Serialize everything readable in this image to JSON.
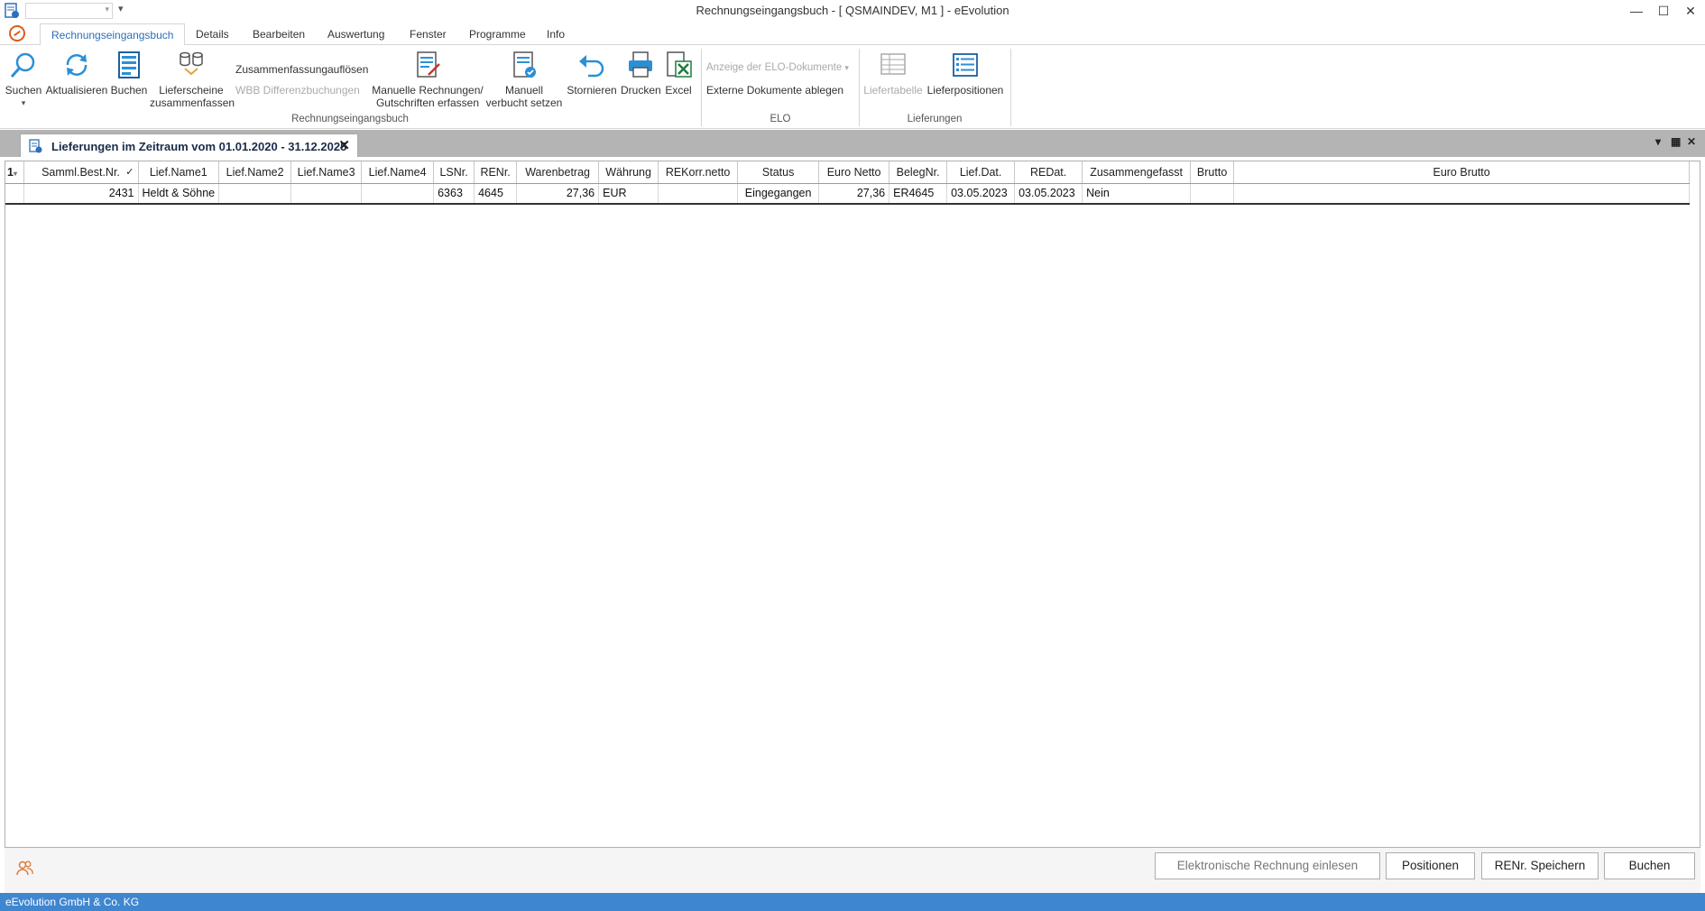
{
  "window": {
    "title": "Rechnungseingangsbuch - [ QSMAINDEV, M1 ]  -  eEvolution",
    "qa_glyph": "▾",
    "combo_arrow": "▾",
    "min_glyph": "—",
    "max_glyph": "☐",
    "close_glyph": "✕"
  },
  "ribbon_tabs": [
    "Rechnungseingangsbuch",
    "Details",
    "Bearbeiten",
    "Auswertung",
    "Fenster",
    "Programme",
    "Info"
  ],
  "ribbon": {
    "suchen": "Suchen",
    "suchen_arrow": "▾",
    "aktualisieren": "Aktualisieren",
    "buchen": "Buchen",
    "lieferscheine_1": "Lieferscheine",
    "lieferscheine_2": "zusammenfassen",
    "zusammenfassung": "Zusammenfassung",
    "aufloesen": "auflösen",
    "wbb": "WBB Differenzbuchungen",
    "manuelle_1": "Manuelle Rechnungen/",
    "manuelle_2": "Gutschriften erfassen",
    "manuell_verbucht_1": "Manuell",
    "manuell_verbucht_2": "verbucht setzen",
    "stornieren": "Stornieren",
    "drucken": "Drucken",
    "excel": "Excel",
    "elo_anzeige": "Anzeige der ELO-Dokumente",
    "elo_arrow": "▾",
    "elo_extern": "Externe Dokumente ablegen",
    "liefertabelle": "Liefertabelle",
    "lieferpositionen": "Lieferpositionen",
    "group_reb": "Rechnungseingangsbuch",
    "group_elo": "ELO",
    "group_lief": "Lieferungen"
  },
  "doc_tab": {
    "title": "Lieferungen im Zeitraum vom 01.01.2020 - 31.12.2025",
    "close": "✕",
    "ctl_menu": "▾",
    "ctl_layout": "▦",
    "ctl_close": "✕"
  },
  "grid": {
    "row_indicator": "1",
    "indicator_arrow": "▾",
    "check_header": "✓",
    "columns": [
      "Samml.Best.Nr.",
      "Lief.Name1",
      "Lief.Name2",
      "Lief.Name3",
      "Lief.Name4",
      "LSNr.",
      "RENr.",
      "Warenbetrag",
      "Währung",
      "REKorr.netto",
      "Status",
      "Euro Netto",
      "BelegNr.",
      "Lief.Dat.",
      "REDat.",
      "Zusammengefasst",
      "Brutto",
      "Euro Brutto"
    ],
    "rows": [
      [
        "2431",
        "Heldt & Söhne",
        "",
        "",
        "",
        "6363",
        "4645",
        "27,36",
        "EUR",
        "",
        "Eingegangen",
        "27,36",
        "ER4645",
        "03.05.2023",
        "03.05.2023",
        "Nein",
        "",
        ""
      ]
    ]
  },
  "footer_buttons": {
    "einlesen": "Elektronische Rechnung einlesen",
    "positionen": "Positionen",
    "speichern": "RENr. Speichern",
    "buchen": "Buchen"
  },
  "status": "eEvolution GmbH & Co. KG",
  "colors": {
    "accent": "#2d6fb8",
    "status_bar": "#3f86d0",
    "logo": "#e05a1a"
  }
}
